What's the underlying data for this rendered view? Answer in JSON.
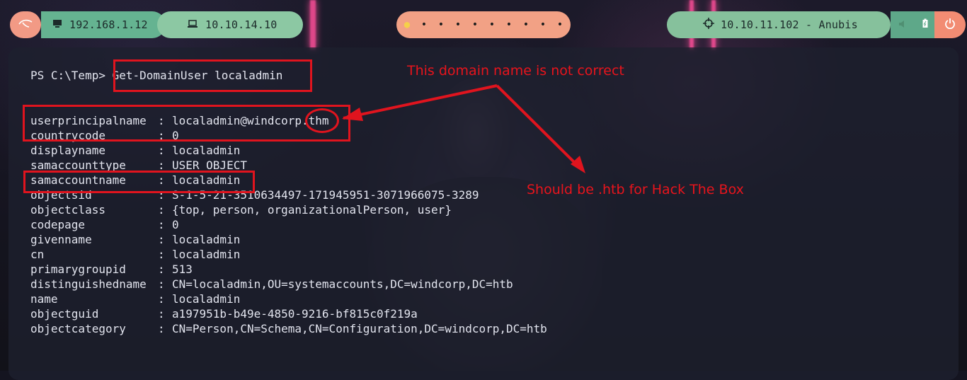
{
  "topbar": {
    "menu_icon": "kali-dragon-icon",
    "host_icon": "monitor-icon",
    "host_ip": "192.168.1.12",
    "vpn_icon": "laptop-icon",
    "vpn_ip": "10.10.14.10",
    "workspaces": [
      "●",
      "•",
      "•",
      "•",
      "•",
      "•",
      "•",
      "•",
      "•",
      "•"
    ],
    "target_icon": "crosshair-icon",
    "target": "10.10.11.102 - Anubis",
    "battery_icon": "battery-icon",
    "volume_icon": "speaker-icon",
    "power_icon": "power-icon",
    "colors": {
      "salmon": "#f29a85",
      "green": "#65b391",
      "mint": "#8cc8a3"
    }
  },
  "terminal": {
    "prompt": "PS C:\\Temp> ",
    "command": "Get-DomainUser localadmin",
    "rows": [
      {
        "key": "userprincipalname",
        "value": "localadmin@windcorp.thm"
      },
      {
        "key": "countrycode",
        "value": "0"
      },
      {
        "key": "displayname",
        "value": "localadmin"
      },
      {
        "key": "samaccounttype",
        "value": "USER_OBJECT"
      },
      {
        "key": "samaccountname",
        "value": "localadmin"
      },
      {
        "key": "objectsid",
        "value": "S-1-5-21-3510634497-171945951-3071966075-3289"
      },
      {
        "key": "objectclass",
        "value": "{top, person, organizationalPerson, user}"
      },
      {
        "key": "codepage",
        "value": "0"
      },
      {
        "key": "givenname",
        "value": "localadmin"
      },
      {
        "key": "cn",
        "value": "localadmin"
      },
      {
        "key": "primarygroupid",
        "value": "513"
      },
      {
        "key": "distinguishedname",
        "value": "CN=localadmin,OU=systemaccounts,DC=windcorp,DC=htb"
      },
      {
        "key": "name",
        "value": "localadmin"
      },
      {
        "key": "objectguid",
        "value": "a197951b-b49e-4850-9216-bf815c0f219a"
      },
      {
        "key": "objectcategory",
        "value": "CN=Person,CN=Schema,CN=Configuration,DC=windcorp,DC=htb"
      }
    ],
    "separator": ": "
  },
  "annotations": {
    "note_domain": "This domain name is not correct",
    "note_htb": "Should be .htb for Hack The Box",
    "color": "#e0141e"
  }
}
